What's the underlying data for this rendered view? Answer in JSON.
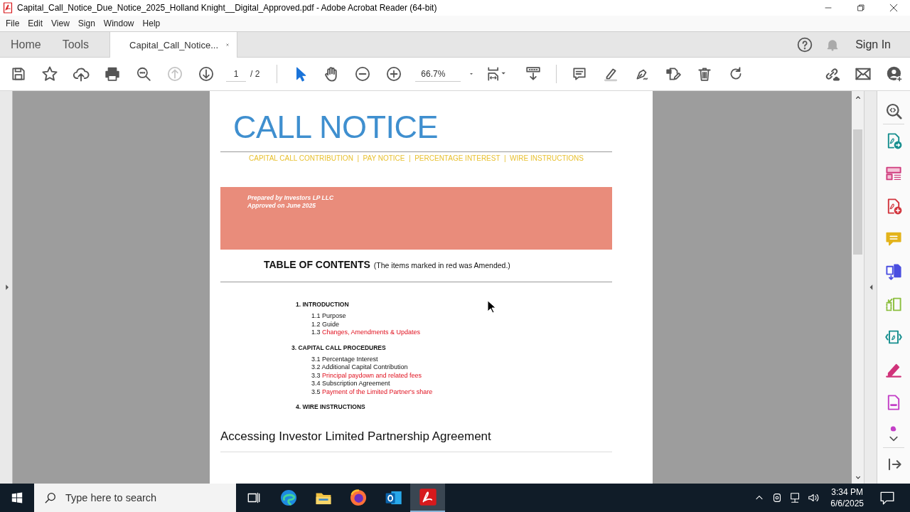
{
  "window": {
    "title": "Capital_Call_Notice_Due_Notice_2025_Holland  Knight__Digital_Approved.pdf - Adobe Acrobat Reader (64-bit)"
  },
  "menu": [
    "File",
    "Edit",
    "View",
    "Sign",
    "Window",
    "Help"
  ],
  "tabs": [
    {
      "label": "Home",
      "selected": false,
      "kind": "nav"
    },
    {
      "label": "Tools",
      "selected": false,
      "kind": "nav"
    },
    {
      "label": "Capital_Call_Notice...",
      "selected": true,
      "kind": "document"
    }
  ],
  "account": {
    "label": "Sign In"
  },
  "toolbar": {
    "page": "1",
    "page_total": "/ 2",
    "zoom": "66.7%"
  },
  "document": {
    "title": "CALL NOTICE",
    "subtitle": "CAPITAL CALL CONTRIBUTION  |  PAY NOTICE  |  PERCENTAGE INTEREST  |  WIRE INSTRUCTIONS",
    "banner": [
      "Prepared by Investors LP LLC",
      "Approved on June 2025"
    ],
    "toc_title": "TABLE OF CONTENTS",
    "toc_note": "(The items marked in red was Amended.)",
    "toc": [
      {
        "number": "1.",
        "title": "INTRODUCTION",
        "children": [
          {
            "number": "1.1",
            "title": "Purpose",
            "amended": false
          },
          {
            "number": "1.2",
            "title": "Guide",
            "amended": false
          },
          {
            "number": "1.3",
            "title": "Changes, Amendments & Updates",
            "amended": true
          }
        ]
      },
      {
        "number": "3.",
        "title": "CAPITAL CALL PROCEDURES",
        "children": [
          {
            "number": "3.1",
            "title": "Percentage Interest",
            "amended": false
          },
          {
            "number": "3.2",
            "title": "Additional Capital Contribution",
            "amended": false
          },
          {
            "number": "3.3",
            "title": "Principal paydown and related fees",
            "amended": true
          },
          {
            "number": "3.4",
            "title": "Subscription Agreement",
            "amended": false
          },
          {
            "number": "3.5",
            "title": "Payment of the Limited Partner's share",
            "amended": true
          }
        ]
      },
      {
        "number": "4.",
        "title": "WIRE INSTRUCTIONS"
      }
    ],
    "section_heading": "Accessing Investor Limited Partnership Agreement"
  },
  "taskbar": {
    "search_placeholder": "Type here to search",
    "apps": [
      {
        "kind": "taskview",
        "selected": false
      },
      {
        "kind": "edge",
        "selected": false
      },
      {
        "kind": "explorer",
        "selected": false
      },
      {
        "kind": "firefox",
        "selected": false
      },
      {
        "kind": "outlook",
        "selected": false
      },
      {
        "kind": "acrobat",
        "selected": true
      }
    ],
    "time": "3:34 PM",
    "date": "6/6/2025"
  }
}
